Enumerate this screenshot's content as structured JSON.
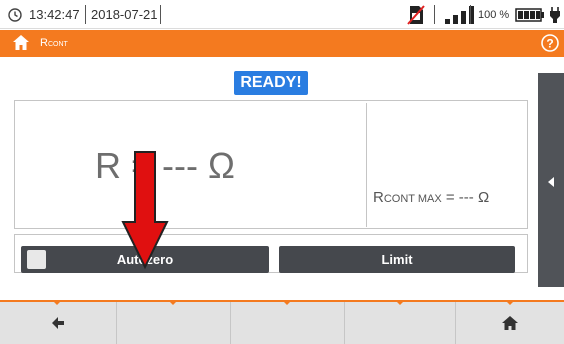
{
  "status": {
    "time": "13:42:47",
    "date": "2018-07-21",
    "battery_percent": "100 %"
  },
  "titlebar": {
    "title": "R",
    "title_sub": "CONT"
  },
  "main": {
    "ready_label": "READY!",
    "result_text": "R = --- Ω",
    "max_label_main": "R",
    "max_label_sub": "CONT MAX",
    "max_value": " = --- Ω"
  },
  "buttons": {
    "autozero_label": "Autozero",
    "limit_label": "Limit"
  },
  "icons": {
    "clock": "clock-icon",
    "no_sim": "no-sim-icon",
    "signal": "signal-icon",
    "battery": "battery-icon",
    "power": "power-plug-icon",
    "home": "home-icon",
    "help": "help-icon",
    "back": "back-arrow-icon",
    "side": "side-panel-arrow-icon"
  },
  "colors": {
    "accent": "#f47a1f",
    "ready": "#2a7de1",
    "button": "#45484d",
    "annotation_arrow": "#e01010"
  }
}
